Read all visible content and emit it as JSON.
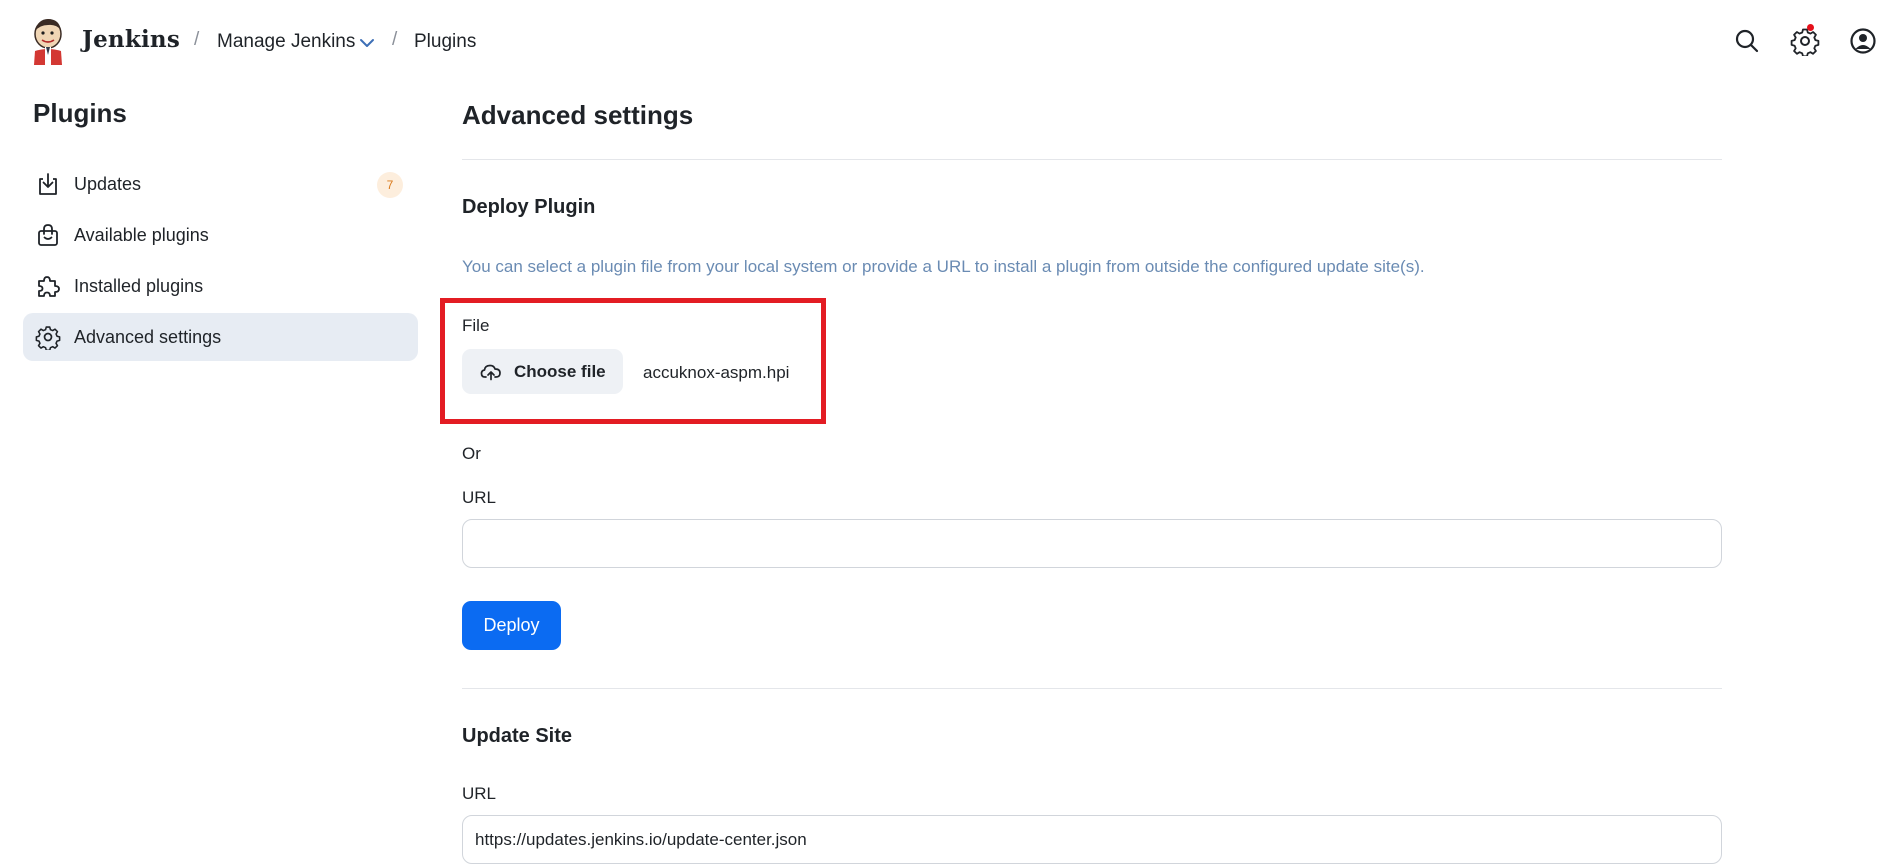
{
  "header": {
    "brand": "Jenkins",
    "breadcrumb": [
      {
        "label": "Manage Jenkins"
      },
      {
        "label": "Plugins"
      }
    ],
    "separator": "/",
    "icons": [
      "search-icon",
      "gear-icon",
      "user-icon"
    ],
    "notification_dot_color": "#e5101a"
  },
  "sidebar": {
    "title": "Plugins",
    "items": [
      {
        "label": "Updates",
        "icon": "download-icon",
        "badge": "7"
      },
      {
        "label": "Available plugins",
        "icon": "shopping-bag-icon"
      },
      {
        "label": "Installed plugins",
        "icon": "puzzle-icon"
      },
      {
        "label": "Advanced settings",
        "icon": "gear-icon",
        "active": true
      }
    ]
  },
  "main": {
    "title": "Advanced settings",
    "deploy": {
      "title": "Deploy Plugin",
      "description": "You can select a plugin file from your local system or provide a URL to install a plugin from outside the configured update site(s).",
      "file_label": "File",
      "choose_file_label": "Choose file",
      "chosen_file": "accuknox-aspm.hpi",
      "or_label": "Or",
      "url_label": "URL",
      "url_value": "",
      "deploy_button": "Deploy"
    },
    "update_site": {
      "title": "Update Site",
      "url_label": "URL",
      "url_value": "https://updates.jenkins.io/update-center.json"
    }
  },
  "colors": {
    "accent": "#0b6bf2",
    "highlight_box": "#e31c23",
    "active_item_bg": "#e7ecf3",
    "badge_bg": "#fdeedd",
    "badge_text": "#d97a1c"
  }
}
